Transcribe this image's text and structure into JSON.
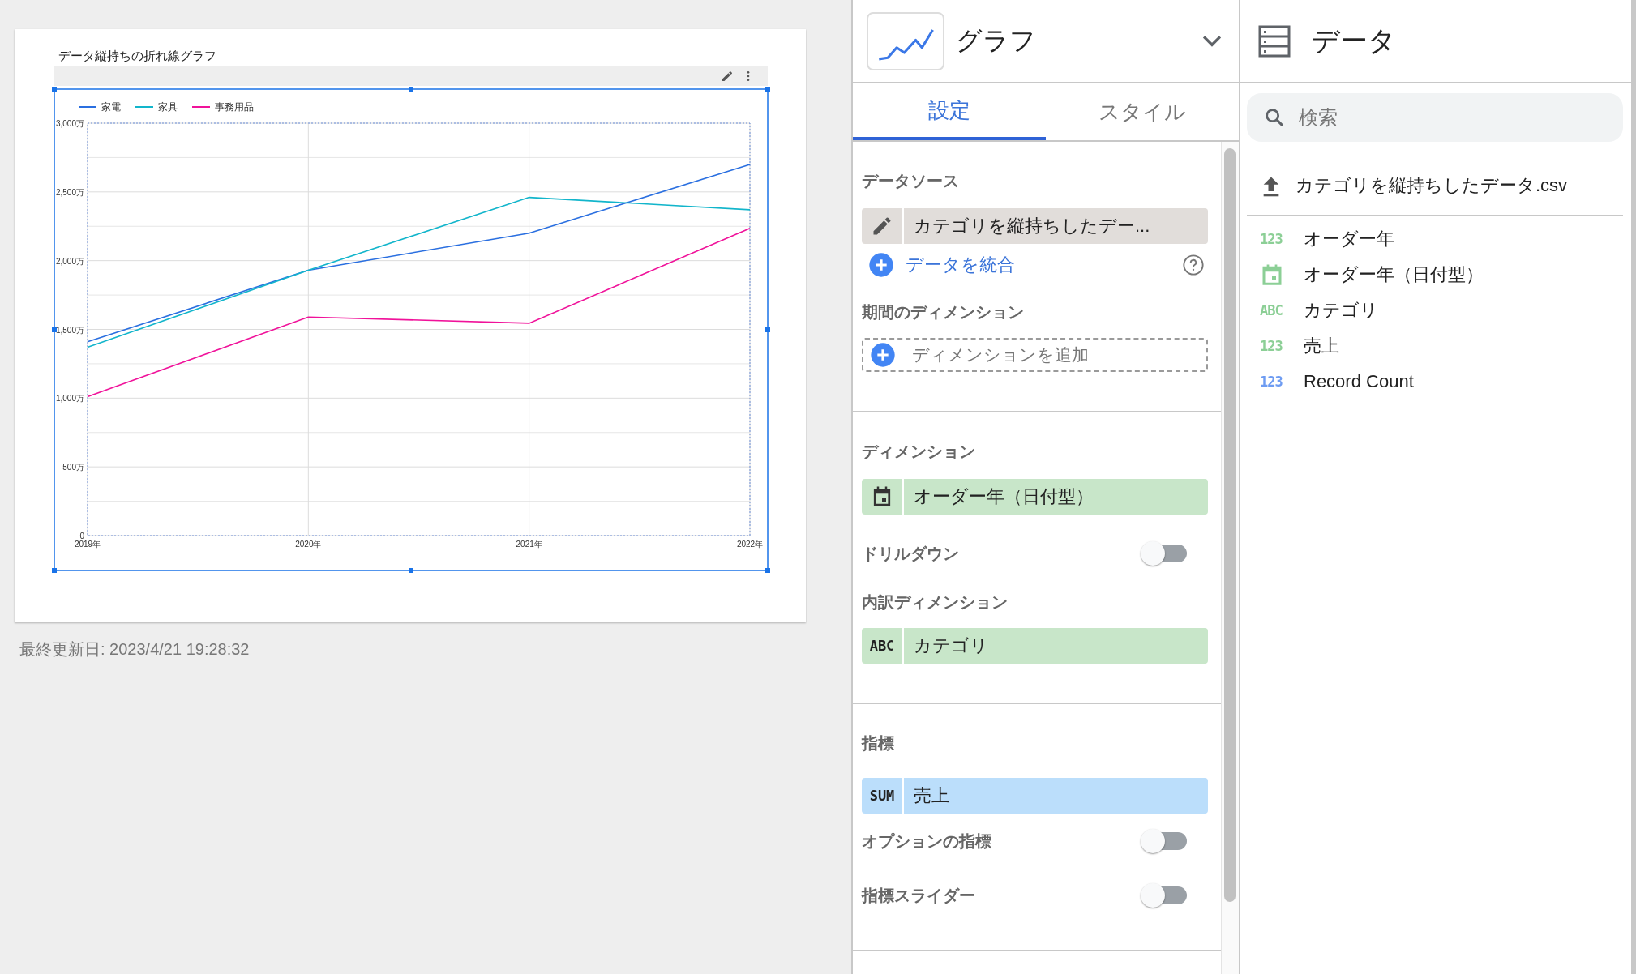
{
  "report": {
    "title": "データ縦持ちの折れ線グラフ",
    "chart_data": {
      "type": "line",
      "categories": [
        "2019年",
        "2020年",
        "2021年",
        "2022年"
      ],
      "series": [
        {
          "name": "家電",
          "color": "#2a6fe0",
          "values": [
            1410,
            1930,
            2200,
            2700
          ]
        },
        {
          "name": "家具",
          "color": "#12b5cb",
          "values": [
            1370,
            1930,
            2460,
            2370
          ]
        },
        {
          "name": "事務用品",
          "color": "#f0129a",
          "values": [
            1010,
            1590,
            1545,
            2235
          ]
        }
      ],
      "grid": true,
      "legend": true,
      "ylim": [
        0,
        3000
      ],
      "yticks": [
        {
          "value": 0,
          "label": "0"
        },
        {
          "value": 500,
          "label": "500万"
        },
        {
          "value": 1000,
          "label": "1,000万"
        },
        {
          "value": 1500,
          "label": "1,500万"
        },
        {
          "value": 2000,
          "label": "2,000万"
        },
        {
          "value": 2500,
          "label": "2,500万"
        },
        {
          "value": 3000,
          "label": "3,000万"
        }
      ]
    },
    "last_updated": "最終更新日: 2023/4/21 19:28:32"
  },
  "properties_panel": {
    "chart_type": "グラフ",
    "tabs": [
      {
        "label": "設定",
        "selected": true
      },
      {
        "label": "スタイル",
        "selected": false
      }
    ],
    "data_source": {
      "heading": "データソース",
      "source": "カテゴリを縦持ちしたデー...",
      "blend_link": "データを統合"
    },
    "date_dimension": {
      "heading": "期間のディメンション",
      "placeholder": "ディメンションを追加"
    },
    "dimension": {
      "heading": "ディメンション",
      "field": {
        "kind": "date",
        "label": "オーダー年（日付型）"
      }
    },
    "drilldown": {
      "label": "ドリルダウン",
      "on": false
    },
    "breakdown": {
      "heading": "内訳ディメンション",
      "field": {
        "kind": "text",
        "badge": "ABC",
        "label": "カテゴリ"
      }
    },
    "metric": {
      "heading": "指標",
      "field": {
        "kind": "aggregate",
        "badge": "SUM",
        "label": "売上"
      }
    },
    "metric_toggles": [
      {
        "label": "オプションの指標",
        "on": false
      },
      {
        "label": "指標スライダー",
        "on": false
      }
    ]
  },
  "data_panel": {
    "title": "データ",
    "search": {
      "placeholder": "検索"
    },
    "file": "カテゴリを縦持ちしたデータ.csv",
    "fields": [
      {
        "kind": "number",
        "badge": "123",
        "label": "オーダー年",
        "color": "#8ccf96"
      },
      {
        "kind": "date",
        "label": "オーダー年（日付型）",
        "color": "#8ccf96"
      },
      {
        "kind": "text",
        "badge": "ABC",
        "label": "カテゴリ",
        "color": "#8ccf96"
      },
      {
        "kind": "number",
        "badge": "123",
        "label": "売上",
        "color": "#8ccf96"
      },
      {
        "kind": "number",
        "badge": "123",
        "label": "Record Count",
        "color": "#6e9cf2"
      }
    ]
  }
}
